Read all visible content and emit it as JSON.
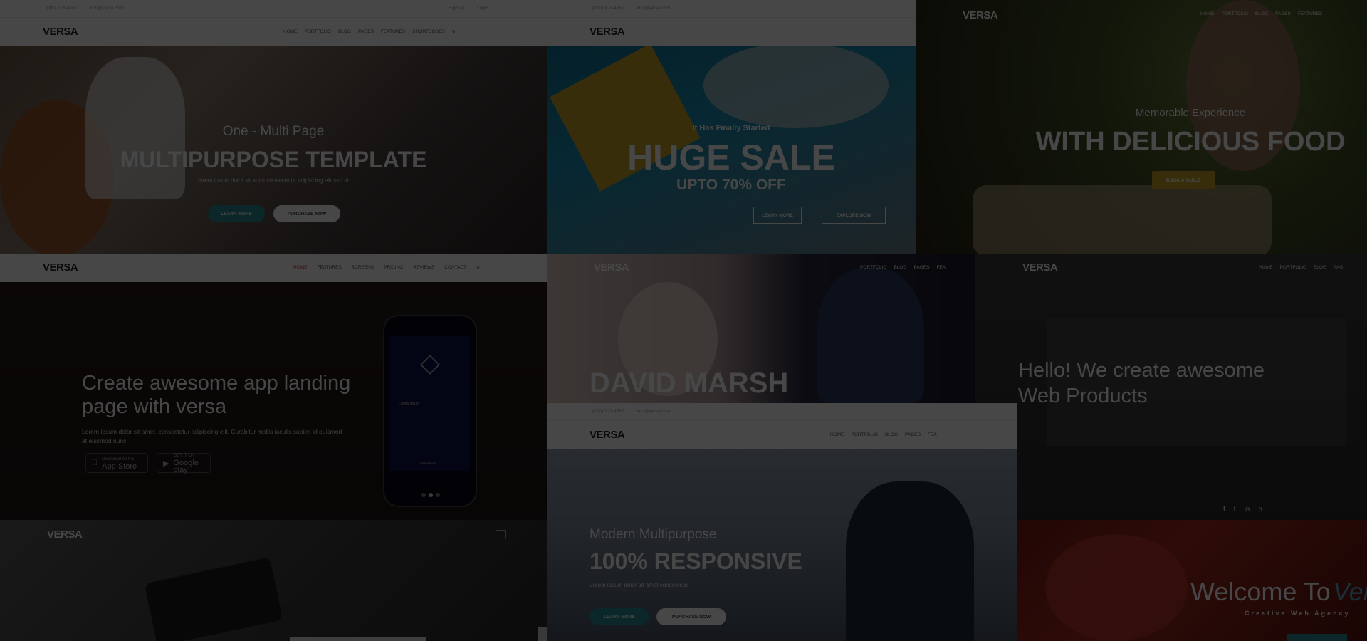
{
  "tiles": {
    "multipurpose": {
      "contact_phone": "(000) 123-4567",
      "contact_email": "info@versa.com",
      "topright_a": "Sign up",
      "topright_b": "Login",
      "logo": "VERSA",
      "nav": [
        "HOME",
        "PORTFOLIO",
        "BLOG",
        "PAGES",
        "FEATURES",
        "SHORTCODES"
      ],
      "kicker": "One - Multi Page",
      "title": "MULTIPURPOSE TEMPLATE",
      "subtitle": "Lorem ipsum dolor sit amet consectetur adipiscing elit sed do",
      "btn_learn": "LEARN MORE",
      "btn_purchase": "PURCHASE NOW"
    },
    "sale": {
      "contact_phone": "(000) 123-4567",
      "contact_email": "info@versa.com",
      "logo": "VERSA",
      "kicker": "It Has Finally Started",
      "title": "HUGE SALE",
      "subtitle": "UPTO 70% OFF",
      "btn_learn": "LEARN MORE",
      "btn_explore": "EXPLORE NOW"
    },
    "food": {
      "logo": "VERSA",
      "nav": [
        "HOME",
        "PORTFOLIO",
        "BLOG",
        "PAGES",
        "FEATURES"
      ],
      "kicker": "Memorable Experience",
      "title": "WITH DELICIOUS FOOD",
      "btn": "BOOK A TABLE"
    },
    "app": {
      "logo": "VERSA",
      "nav": [
        "HOME",
        "FEATURES",
        "SCREENS",
        "PRICING",
        "REVIEWS",
        "CONTACT"
      ],
      "title_line1": "Create awesome app landing",
      "title_line2": "page with versa",
      "body": "Lorem ipsum dolor sit amet, consectetur adipiscing elit. Curabitur mollis iaculis sapien id euismod at euismod nunc.",
      "appstore_small": "Download on the",
      "appstore": "App Store",
      "googleplay_small": "GET IT ON",
      "googleplay": "Google play",
      "phone_caption": "Lorem Ipsum",
      "phone_footer": "Learn More"
    },
    "personal": {
      "logo": "VERSA",
      "nav": [
        "PORTFOLIO",
        "BLOG",
        "PAGES",
        "FEA"
      ],
      "title": "DAVID MARSH"
    },
    "agency": {
      "logo": "VERSA",
      "nav": [
        "HOME",
        "PORTFOLIO",
        "BLOG",
        "PAG"
      ],
      "title_line1": "Hello! We create awesome",
      "title_line2": "Web Products",
      "social": [
        "f",
        "t",
        "in",
        "p"
      ]
    },
    "responsive": {
      "contact_phone": "(000) 123-4567",
      "contact_email": "info@versa.com",
      "logo": "VERSA",
      "nav": [
        "HOME",
        "PORTFOLIO",
        "BLOG",
        "PAGES",
        "FEA"
      ],
      "kicker": "Modern Multipurpose",
      "title": "100% RESPONSIVE",
      "subtitle": "Lorem ipsum dolor sit amet consectetur",
      "btn_learn": "LEARN MORE",
      "btn_purchase": "PURCHASE NOW"
    },
    "dark": {
      "logo": "VERSA"
    },
    "welcome": {
      "title": "Welcome To",
      "script": "Versa",
      "subtitle": "Creative Web Agency"
    }
  },
  "colors": {
    "accent": "#2a8c93",
    "gold": "#c9a227"
  }
}
